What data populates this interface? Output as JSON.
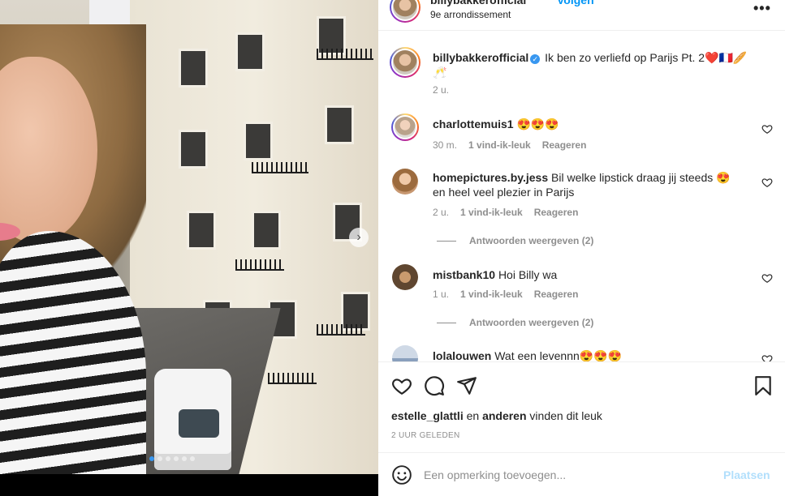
{
  "post": {
    "username": "billybakkerofficial",
    "follow_label": "Volgen",
    "location": "9e arrondissement",
    "more_label": "•••",
    "carousel_next": "›",
    "caption": {
      "username": "billybakkerofficial",
      "text": "Ik ben zo verliefd op Parijs Pt. 2❤️🇫🇷🥖",
      "text_line2": "🥂",
      "time": "2 u."
    }
  },
  "comments": [
    {
      "username": "charlottemuis1",
      "text": "😍😍😍",
      "time": "30 m.",
      "likes": "1 vind-ik-leuk",
      "reply": "Reageren"
    },
    {
      "username": "homepictures.by.jess",
      "text": "Bil welke lipstick draag jij steeds 😍",
      "text_line2": "en heel veel plezier in Parijs",
      "time": "2 u.",
      "likes": "1 vind-ik-leuk",
      "reply": "Reageren",
      "view_replies": "Antwoorden weergeven (2)"
    },
    {
      "username": "mistbank10",
      "text": "Hoi Billy wa",
      "time": "1 u.",
      "likes": "1 vind-ik-leuk",
      "reply": "Reageren",
      "view_replies": "Antwoorden weergeven (2)"
    },
    {
      "username": "lolalouwen",
      "text": "Wat een levennn😍😍😍"
    }
  ],
  "likes_line": {
    "user": "estelle_glattli",
    "middle": "en",
    "others": "anderen",
    "suffix": "vinden dit leuk"
  },
  "timestamp": "2 UUR GELEDEN",
  "composer": {
    "placeholder": "Een opmerking toevoegen...",
    "post_label": "Plaatsen"
  },
  "icons": [
    "heart-icon",
    "comment-icon",
    "share-icon",
    "bookmark-icon",
    "emoji-icon",
    "verified-icon",
    "more-icon"
  ],
  "colors": {
    "accent": "#0095f6",
    "post_disabled": "#b2dffc",
    "verified": "#3897f0",
    "secondary_text": "#8e8e8e"
  }
}
